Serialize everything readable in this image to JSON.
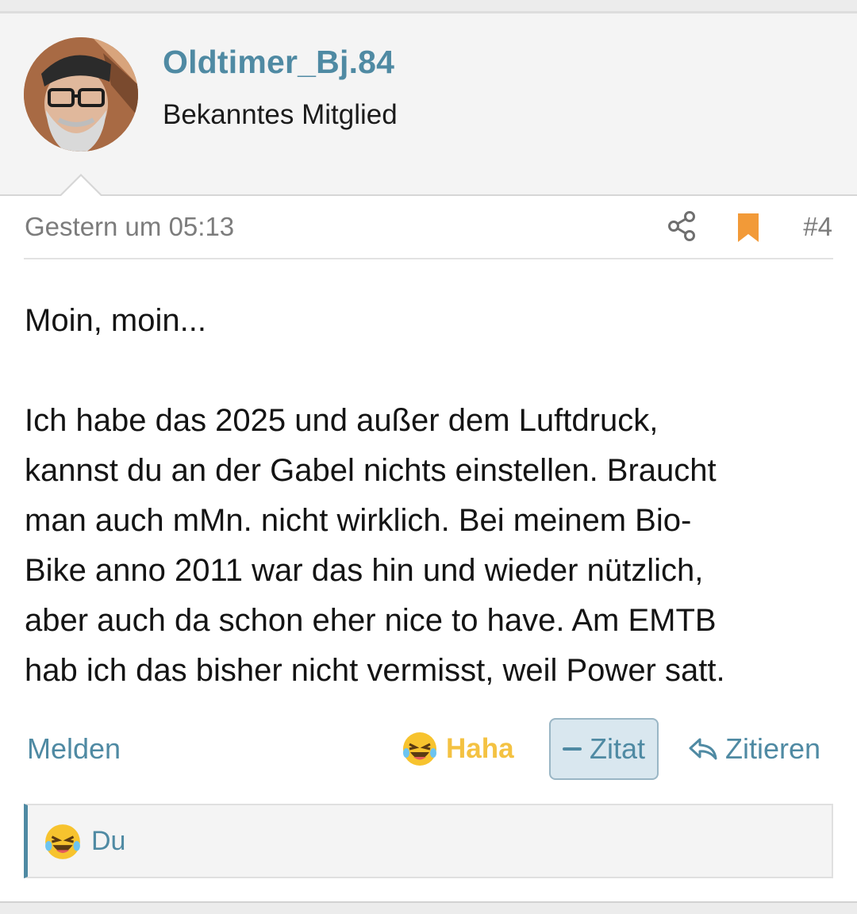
{
  "user": {
    "name": "Oldtimer_Bj.84",
    "title": "Bekanntes Mitglied"
  },
  "post": {
    "timestamp": "Gestern um 05:13",
    "number": "#4",
    "greeting": "Moin, moin...",
    "lines": [
      "Ich habe das 2025 und außer dem Luftdruck,",
      "kannst du an der Gabel nichts einstellen. Braucht",
      "man auch mMn. nicht wirklich. Bei meinem Bio-",
      "Bike anno 2011 war das hin und wieder nützlich,",
      "aber auch da schon eher nice to have. Am EMTB",
      "hab ich das bisher nicht vermisst, weil Power satt."
    ]
  },
  "actions": {
    "report": "Melden",
    "reaction": "Haha",
    "quote_toggle": "Zitat",
    "reply": "Zitieren"
  },
  "reactions_summary": {
    "who": "Du"
  },
  "colors": {
    "accent": "#4f8aa3",
    "bookmark": "#f29a38",
    "haha": "#f4c242"
  },
  "icons": [
    "share-icon",
    "bookmark-icon",
    "laughing-emoji-icon",
    "reply-arrow-icon"
  ]
}
